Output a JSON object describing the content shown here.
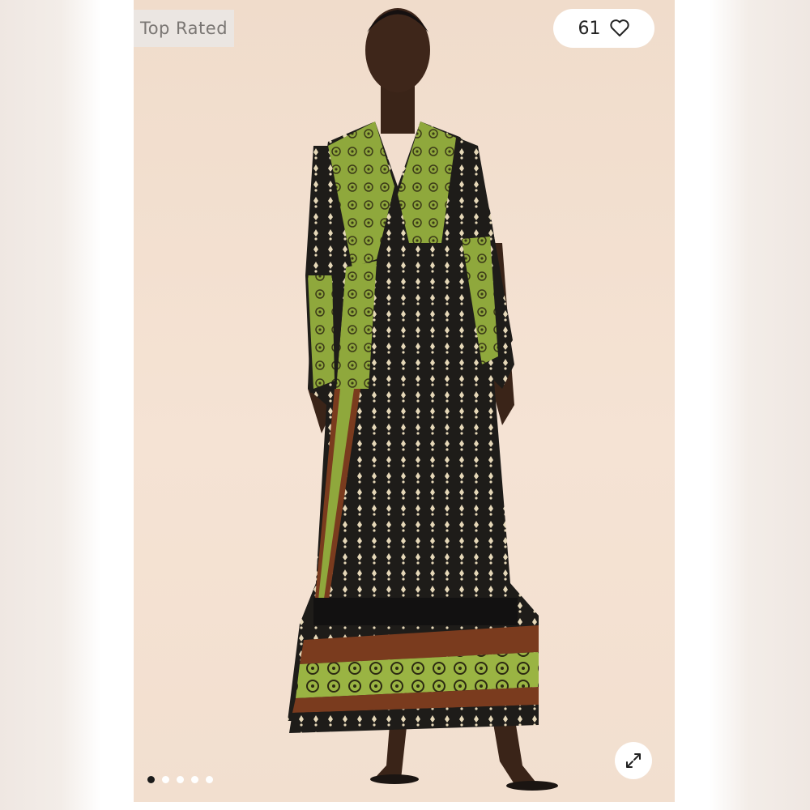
{
  "badge": {
    "label": "Top Rated"
  },
  "likes": {
    "count": "61",
    "icon": "heart-icon"
  },
  "expand": {
    "icon": "expand-arrows-icon"
  },
  "carousel": {
    "total": 5,
    "active": 0
  },
  "colors": {
    "backdrop": "#f2dfcf",
    "dress_black": "#1e1c19",
    "dress_green": "#8aa43a",
    "dress_rust": "#7a3b1e",
    "dress_cream": "#e9dcc0"
  }
}
